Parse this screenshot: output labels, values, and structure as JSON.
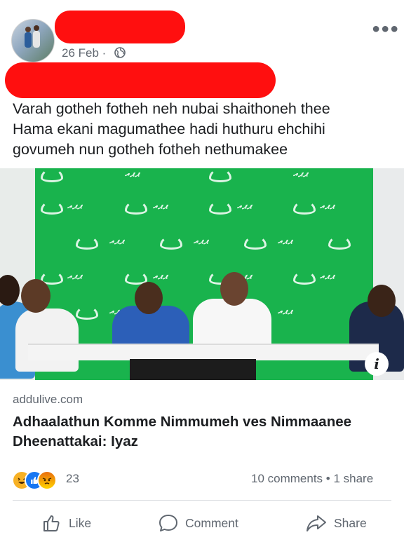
{
  "post": {
    "date": "26 Feb",
    "separator": "·",
    "caption_lines": [
      "Varah gotheh fotheh neh nubai shaithoneh thee",
      "Hama ekani magumathee hadi huthuru ehchihi",
      "govumeh nun gotheh fotheh nethumakee"
    ]
  },
  "link_preview": {
    "domain": "addulive.com",
    "headline": "Adhaalathun Komme Nimmumeh ves Nimmaanee Dheenattakai: Iyaz",
    "image_backdrop_text": "ރަށް"
  },
  "engagement": {
    "reaction_count": "23",
    "reaction_types": [
      "haha",
      "like",
      "angry"
    ],
    "stats": "10 comments • 1 share"
  },
  "actions": {
    "like": "Like",
    "comment": "Comment",
    "share": "Share"
  },
  "icons": {
    "privacy": "globe-icon",
    "more": "more-options-icon",
    "info": "info-icon",
    "like": "thumbs-up-icon",
    "comment": "speech-bubble-icon",
    "share": "share-arrow-icon"
  },
  "colors": {
    "redaction": "#ff0f0f",
    "backdrop_green": "#19b34d",
    "brand_red": "#e52f2f",
    "secondary_text": "#606770",
    "like_blue": "#1877f2"
  }
}
